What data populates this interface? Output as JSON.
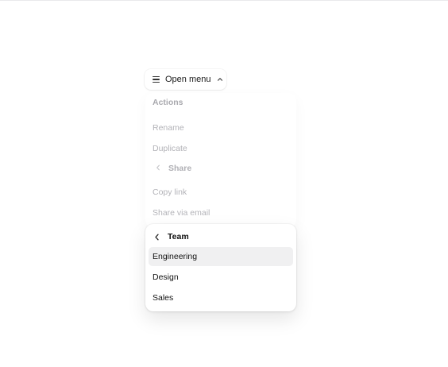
{
  "trigger": {
    "label": "Open menu",
    "icon": "menu-icon",
    "chevron_icon": "chevron-up-icon"
  },
  "menu": {
    "group_label": "Actions",
    "items": [
      "Rename",
      "Duplicate"
    ],
    "submenu_label": "Share",
    "share_items": [
      "Copy link",
      "Share via email"
    ]
  },
  "team_submenu": {
    "title": "Team",
    "back_icon": "chevron-left-icon",
    "items": [
      "Engineering",
      "Design",
      "Sales"
    ],
    "highlighted_item": "Engineering"
  },
  "colors": {
    "highlight": "#f0f0f1",
    "faded_text": "#b3b3b8",
    "text": "#111111"
  }
}
